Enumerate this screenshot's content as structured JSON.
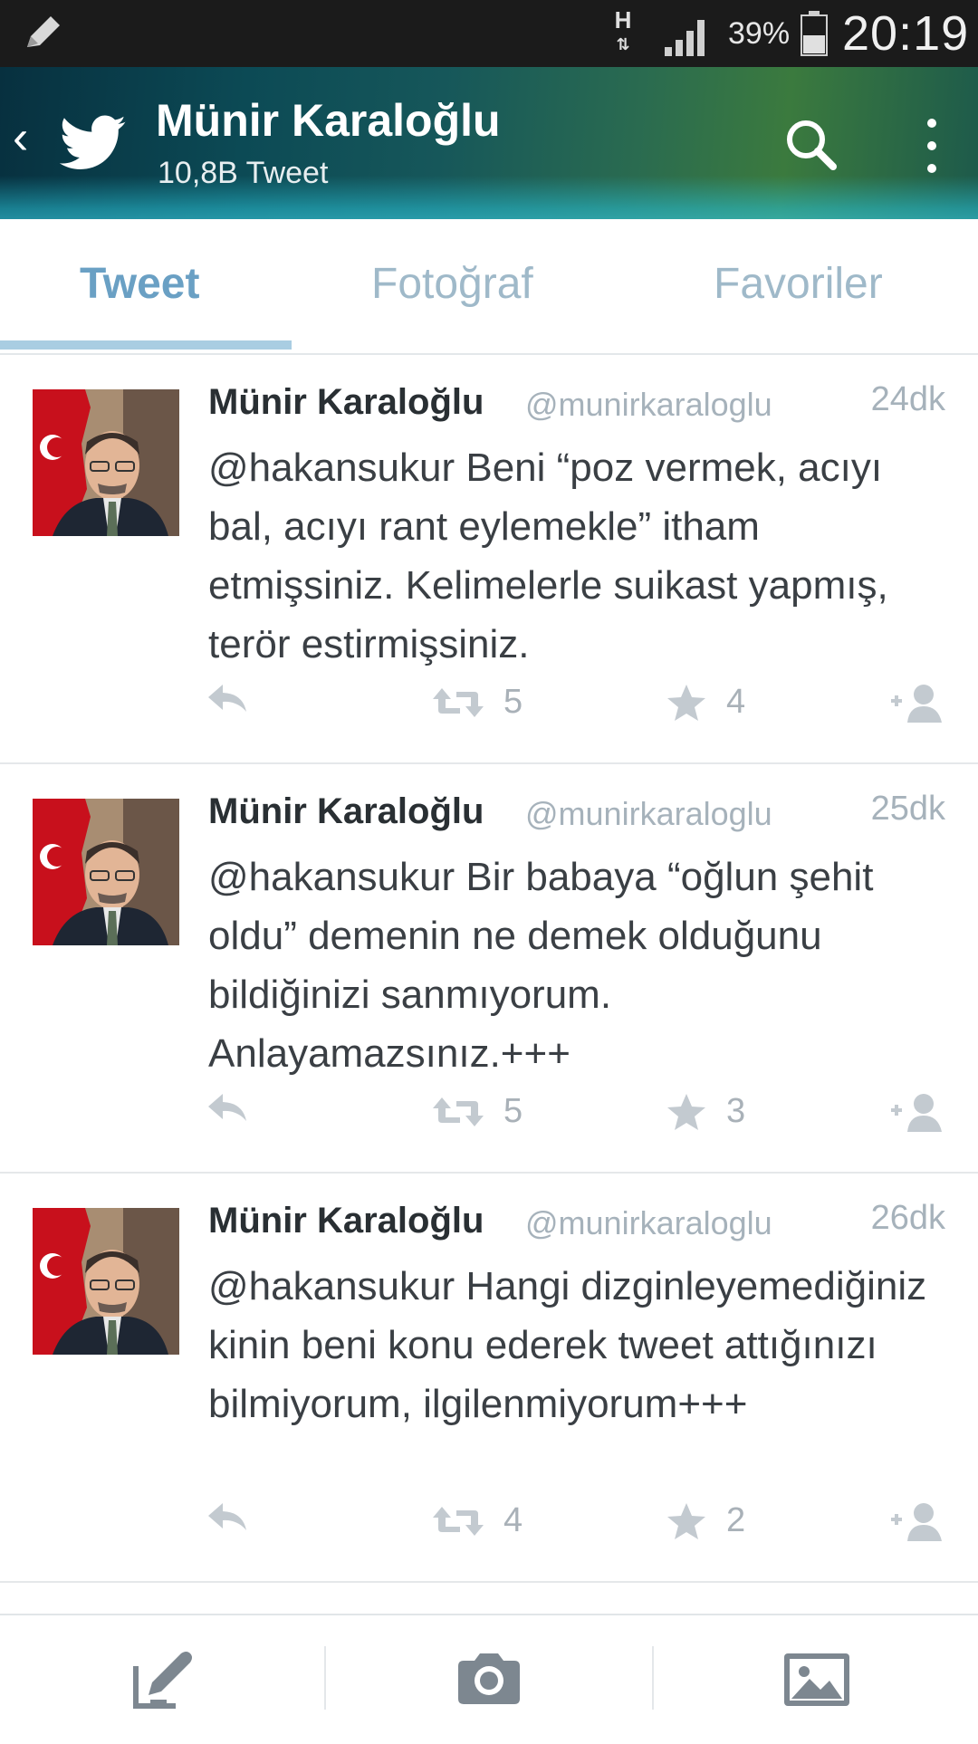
{
  "status_bar": {
    "network": "H",
    "battery_percent": "39%",
    "time": "20:19",
    "icons": [
      "pencil-icon",
      "network-h-icon",
      "signal-icon",
      "battery-icon"
    ]
  },
  "header": {
    "name": "Münir Karaloğlu",
    "tweet_count": "10,8B Tweet",
    "icons": [
      "back-icon",
      "twitter-bird-icon",
      "search-icon",
      "overflow-menu-icon"
    ]
  },
  "tabs": [
    {
      "label": "Tweet",
      "active": true
    },
    {
      "label": "Fotoğraf",
      "active": false
    },
    {
      "label": "Favoriler",
      "active": false
    }
  ],
  "tweets": [
    {
      "name": "Münir Karaloğlu",
      "handle": "@munirkaraloglu",
      "time": "24dk",
      "text": "@hakansukur Beni “poz vermek, acıyı bal, acıyı rant eylemekle” itham etmişsiniz. Kelimelerle suikast yapmış, terör estirmişsiniz.",
      "retweets": "5",
      "favorites": "4"
    },
    {
      "name": "Münir Karaloğlu",
      "handle": "@munirkaraloglu",
      "time": "25dk",
      "text": "@hakansukur Bir babaya “oğlun şehit oldu” demenin ne demek olduğunu bildiğinizi sanmıyorum. Anlayamazsınız.+++",
      "retweets": "5",
      "favorites": "3"
    },
    {
      "name": "Münir Karaloğlu",
      "handle": "@munirkaraloglu",
      "time": "26dk",
      "text": "@hakansukur Hangi dizginleyemediğiniz kinin beni konu ederek tweet attığınızı bilmiyorum, ilgilenmiyorum+++",
      "retweets": "4",
      "favorites": "2"
    }
  ],
  "bottom_bar": {
    "icons": [
      "compose-icon",
      "camera-icon",
      "gallery-icon"
    ]
  },
  "colors": {
    "tab_active": "#6aa0c4",
    "tab_inactive": "#9fb9c9",
    "muted": "#a6b2bb",
    "status_bar_bg": "#1b1b1b"
  }
}
